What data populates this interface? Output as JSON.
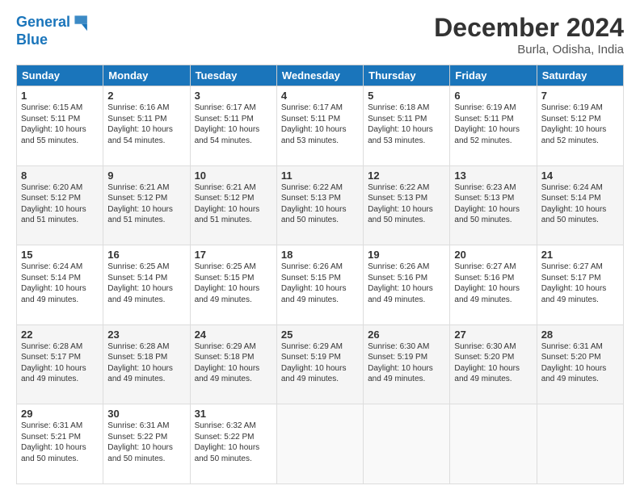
{
  "logo": {
    "line1": "General",
    "line2": "Blue"
  },
  "header": {
    "month": "December 2024",
    "location": "Burla, Odisha, India"
  },
  "weekdays": [
    "Sunday",
    "Monday",
    "Tuesday",
    "Wednesday",
    "Thursday",
    "Friday",
    "Saturday"
  ],
  "weeks": [
    [
      {
        "day": "1",
        "info": "Sunrise: 6:15 AM\nSunset: 5:11 PM\nDaylight: 10 hours\nand 55 minutes."
      },
      {
        "day": "2",
        "info": "Sunrise: 6:16 AM\nSunset: 5:11 PM\nDaylight: 10 hours\nand 54 minutes."
      },
      {
        "day": "3",
        "info": "Sunrise: 6:17 AM\nSunset: 5:11 PM\nDaylight: 10 hours\nand 54 minutes."
      },
      {
        "day": "4",
        "info": "Sunrise: 6:17 AM\nSunset: 5:11 PM\nDaylight: 10 hours\nand 53 minutes."
      },
      {
        "day": "5",
        "info": "Sunrise: 6:18 AM\nSunset: 5:11 PM\nDaylight: 10 hours\nand 53 minutes."
      },
      {
        "day": "6",
        "info": "Sunrise: 6:19 AM\nSunset: 5:11 PM\nDaylight: 10 hours\nand 52 minutes."
      },
      {
        "day": "7",
        "info": "Sunrise: 6:19 AM\nSunset: 5:12 PM\nDaylight: 10 hours\nand 52 minutes."
      }
    ],
    [
      {
        "day": "8",
        "info": "Sunrise: 6:20 AM\nSunset: 5:12 PM\nDaylight: 10 hours\nand 51 minutes."
      },
      {
        "day": "9",
        "info": "Sunrise: 6:21 AM\nSunset: 5:12 PM\nDaylight: 10 hours\nand 51 minutes."
      },
      {
        "day": "10",
        "info": "Sunrise: 6:21 AM\nSunset: 5:12 PM\nDaylight: 10 hours\nand 51 minutes."
      },
      {
        "day": "11",
        "info": "Sunrise: 6:22 AM\nSunset: 5:13 PM\nDaylight: 10 hours\nand 50 minutes."
      },
      {
        "day": "12",
        "info": "Sunrise: 6:22 AM\nSunset: 5:13 PM\nDaylight: 10 hours\nand 50 minutes."
      },
      {
        "day": "13",
        "info": "Sunrise: 6:23 AM\nSunset: 5:13 PM\nDaylight: 10 hours\nand 50 minutes."
      },
      {
        "day": "14",
        "info": "Sunrise: 6:24 AM\nSunset: 5:14 PM\nDaylight: 10 hours\nand 50 minutes."
      }
    ],
    [
      {
        "day": "15",
        "info": "Sunrise: 6:24 AM\nSunset: 5:14 PM\nDaylight: 10 hours\nand 49 minutes."
      },
      {
        "day": "16",
        "info": "Sunrise: 6:25 AM\nSunset: 5:14 PM\nDaylight: 10 hours\nand 49 minutes."
      },
      {
        "day": "17",
        "info": "Sunrise: 6:25 AM\nSunset: 5:15 PM\nDaylight: 10 hours\nand 49 minutes."
      },
      {
        "day": "18",
        "info": "Sunrise: 6:26 AM\nSunset: 5:15 PM\nDaylight: 10 hours\nand 49 minutes."
      },
      {
        "day": "19",
        "info": "Sunrise: 6:26 AM\nSunset: 5:16 PM\nDaylight: 10 hours\nand 49 minutes."
      },
      {
        "day": "20",
        "info": "Sunrise: 6:27 AM\nSunset: 5:16 PM\nDaylight: 10 hours\nand 49 minutes."
      },
      {
        "day": "21",
        "info": "Sunrise: 6:27 AM\nSunset: 5:17 PM\nDaylight: 10 hours\nand 49 minutes."
      }
    ],
    [
      {
        "day": "22",
        "info": "Sunrise: 6:28 AM\nSunset: 5:17 PM\nDaylight: 10 hours\nand 49 minutes."
      },
      {
        "day": "23",
        "info": "Sunrise: 6:28 AM\nSunset: 5:18 PM\nDaylight: 10 hours\nand 49 minutes."
      },
      {
        "day": "24",
        "info": "Sunrise: 6:29 AM\nSunset: 5:18 PM\nDaylight: 10 hours\nand 49 minutes."
      },
      {
        "day": "25",
        "info": "Sunrise: 6:29 AM\nSunset: 5:19 PM\nDaylight: 10 hours\nand 49 minutes."
      },
      {
        "day": "26",
        "info": "Sunrise: 6:30 AM\nSunset: 5:19 PM\nDaylight: 10 hours\nand 49 minutes."
      },
      {
        "day": "27",
        "info": "Sunrise: 6:30 AM\nSunset: 5:20 PM\nDaylight: 10 hours\nand 49 minutes."
      },
      {
        "day": "28",
        "info": "Sunrise: 6:31 AM\nSunset: 5:20 PM\nDaylight: 10 hours\nand 49 minutes."
      }
    ],
    [
      {
        "day": "29",
        "info": "Sunrise: 6:31 AM\nSunset: 5:21 PM\nDaylight: 10 hours\nand 50 minutes."
      },
      {
        "day": "30",
        "info": "Sunrise: 6:31 AM\nSunset: 5:22 PM\nDaylight: 10 hours\nand 50 minutes."
      },
      {
        "day": "31",
        "info": "Sunrise: 6:32 AM\nSunset: 5:22 PM\nDaylight: 10 hours\nand 50 minutes."
      },
      null,
      null,
      null,
      null
    ]
  ]
}
